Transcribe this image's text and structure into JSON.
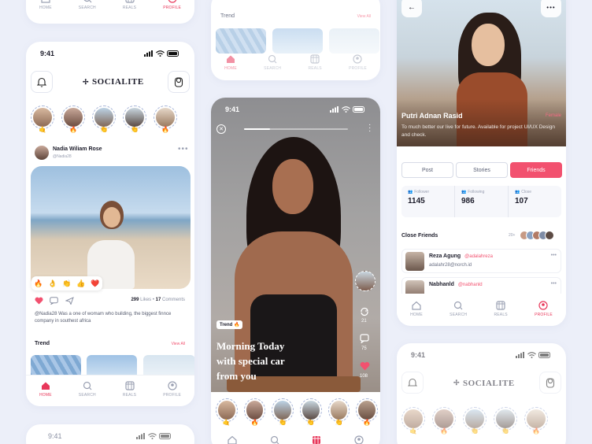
{
  "nav_labels": {
    "home": "HOME",
    "search": "SEARCH",
    "reals": "REALS",
    "profile": "PROFILE"
  },
  "feed": {
    "time": "9:41",
    "brand": "SOCIALITE",
    "post": {
      "author": "Nadia Wiliam Rose",
      "handle": "@Nadia28",
      "likes_count": "299",
      "likes_label": "Likes",
      "comments_count": "17",
      "comments_label": "Comments",
      "caption": "@Nadia28 Was a one of womam who building, the biggest finnce company in southest africa",
      "reactions": [
        "🔥",
        "👌",
        "👏",
        "👍",
        "❤️"
      ]
    },
    "trend_title": "Trend",
    "view_all": "View All"
  },
  "top_middle": {
    "trend_title": "Trend",
    "view_all": "View All"
  },
  "reel": {
    "time": "9:41",
    "trend_tag": "Trend 🔥",
    "headline_1": "Morning Today",
    "headline_2": "with special car",
    "headline_3": "from you",
    "count_shares": "21",
    "count_comments": "75",
    "count_likes": "108"
  },
  "profile": {
    "name": "Putri Adnan Rasid",
    "gender": "Female",
    "bio": "To much better our live for future. Available for project UI/UX Design and check.",
    "tabs": [
      "Post",
      "Stories",
      "Friends"
    ],
    "stats": [
      {
        "label": "Follower",
        "value": "1145"
      },
      {
        "label": "Following",
        "value": "986"
      },
      {
        "label": "Close",
        "value": "107"
      }
    ],
    "close_friends_title": "Close Friends",
    "close_friends_count": "20+",
    "friends": [
      {
        "name": "Reza Agung",
        "handle": "@adalahreza",
        "sub": "adalahr28@norch.id"
      },
      {
        "name": "Nabhanld",
        "handle": "@nabhanld",
        "sub": ""
      }
    ]
  },
  "bottom_right": {
    "time": "9:41",
    "brand": "SOCIALITE"
  },
  "bottom_left": {
    "time": "9:41"
  },
  "colors": {
    "accent": "#f2516f",
    "background": "#eceff9"
  }
}
